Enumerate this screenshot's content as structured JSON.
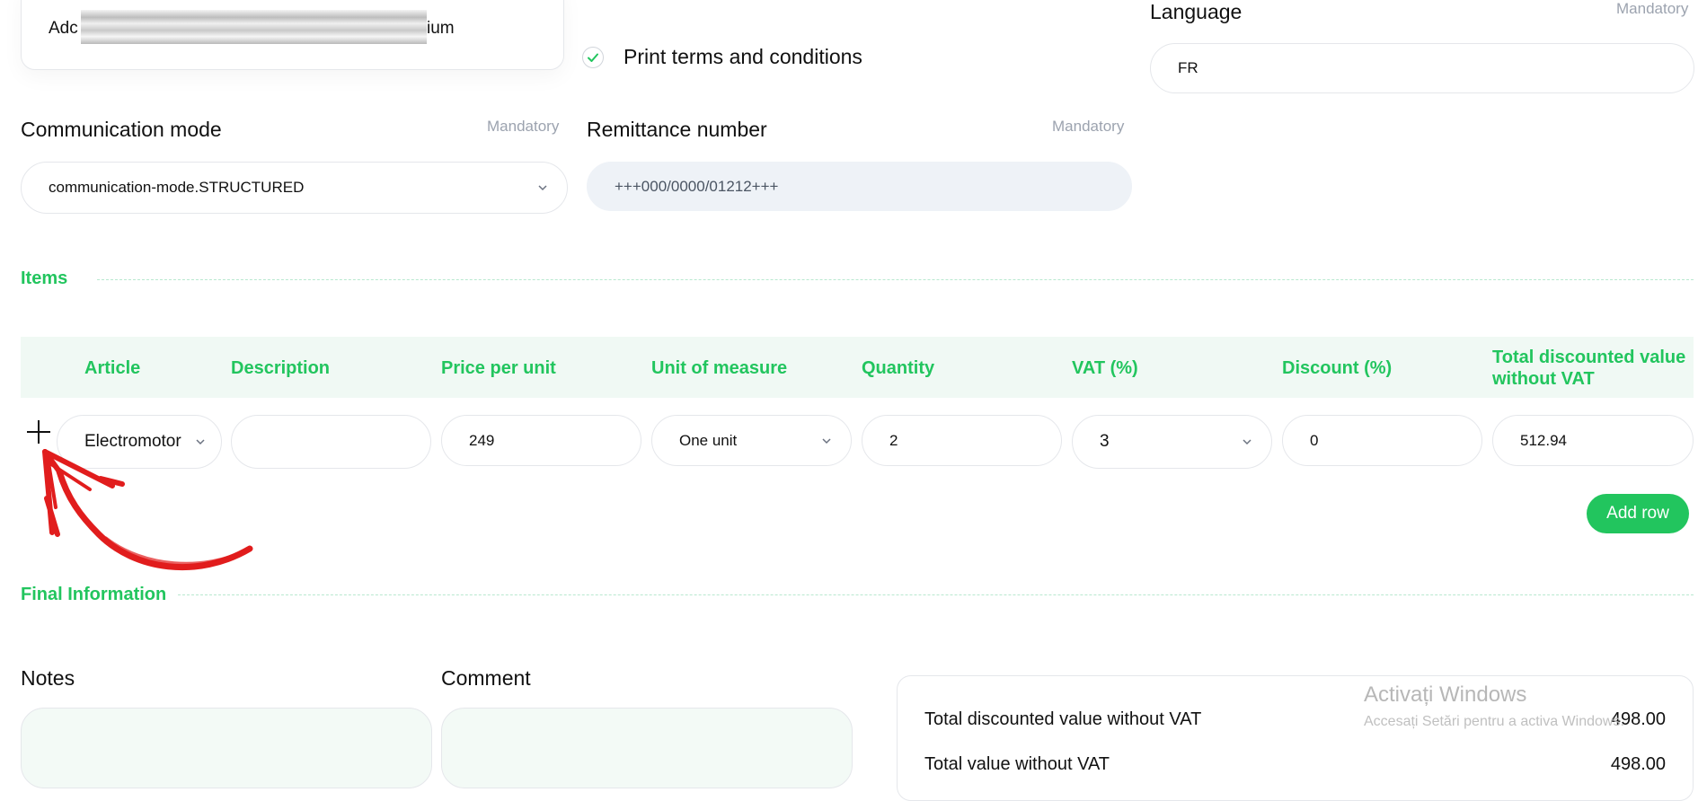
{
  "address": {
    "prefix": "Adc",
    "suffix": "ium"
  },
  "print_terms": {
    "label": "Print terms and conditions",
    "checked": true
  },
  "language": {
    "label": "Language",
    "mandatory": "Mandatory",
    "value": "FR"
  },
  "communication_mode": {
    "label": "Communication mode",
    "mandatory": "Mandatory",
    "value": "communication-mode.STRUCTURED"
  },
  "remittance": {
    "label": "Remittance number",
    "mandatory": "Mandatory",
    "value": "+++000/0000/01212+++"
  },
  "items_section": {
    "title": "Items"
  },
  "table": {
    "headers": {
      "article": "Article",
      "description": "Description",
      "price": "Price per unit",
      "unit": "Unit of measure",
      "quantity": "Quantity",
      "vat": "VAT (%)",
      "discount": "Discount (%)",
      "total_line1": "Total discounted value",
      "total_line2": "without VAT"
    },
    "row": {
      "article": "Electromotor",
      "description": "",
      "price": "249",
      "unit": "One unit",
      "quantity": "2",
      "vat": "3",
      "discount": "0",
      "total": "512.94"
    },
    "add_row_label": "Add row"
  },
  "final_section": {
    "title": "Final Information"
  },
  "notes": {
    "label": "Notes"
  },
  "comment": {
    "label": "Comment"
  },
  "totals": {
    "rows": [
      {
        "label": "Total discounted value without VAT",
        "value": "498.00"
      },
      {
        "label": "Total value without VAT",
        "value": "498.00"
      }
    ]
  },
  "watermark": {
    "title": "Activați Windows",
    "subtitle": "Accesați Setări pentru a activa Windows."
  },
  "colors": {
    "accent": "#22c55e",
    "annotation": "#e11d1d"
  },
  "icons": [
    "check-icon",
    "chevron-down-icon",
    "plus-icon",
    "annotation-arrow"
  ]
}
